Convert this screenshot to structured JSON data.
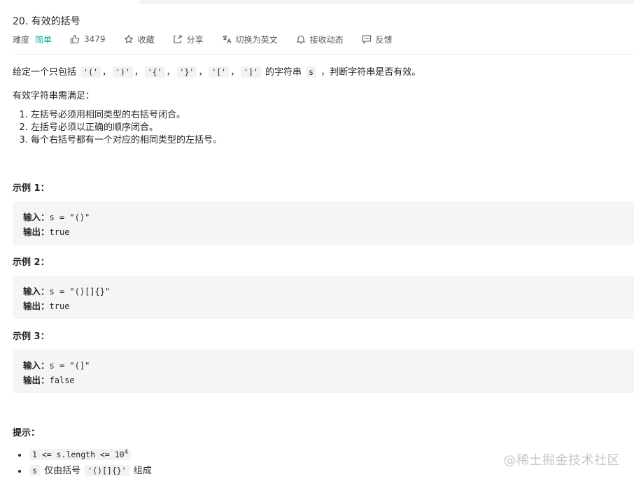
{
  "problem": {
    "title": "20. 有效的括号",
    "difficulty_label": "难度",
    "difficulty": "简单",
    "likes": "3479",
    "actions": [
      "收藏",
      "分享",
      "切换为英文",
      "接收动态",
      "反馈"
    ]
  },
  "description": {
    "intro_prefix": "给定一个只包括 ",
    "chars": [
      "'('",
      "')'",
      "'{'",
      "'}'",
      "'['",
      "']'"
    ],
    "intro_mid": " 的字符串 ",
    "var_s": "s",
    "intro_suffix": " ，判断字符串是否有效。",
    "requirement_heading": "有效字符串需满足：",
    "rules": [
      "左括号必须用相同类型的右括号闭合。",
      "左括号必须以正确的顺序闭合。",
      "每个右括号都有一个对应的相同类型的左括号。"
    ]
  },
  "examples": [
    {
      "title": "示例 1：",
      "input_label": "输入：",
      "input": "s = \"()\"",
      "output_label": "输出：",
      "output": "true"
    },
    {
      "title": "示例 2：",
      "input_label": "输入：",
      "input": "s = \"()[]{}\"",
      "output_label": "输出：",
      "output": "true"
    },
    {
      "title": "示例 3：",
      "input_label": "输入：",
      "input": "s = \"(]\"",
      "output_label": "输出：",
      "output": "false"
    }
  ],
  "hints": {
    "heading": "提示：",
    "constraint_prefix": "1 <= s.length <= 10",
    "constraint_exp": "4",
    "var_s": "s",
    "only_brackets_text": " 仅由括号 ",
    "brackets": "'()[]{}'",
    "composed_text": " 组成"
  },
  "watermark": "@稀土掘金技术社区",
  "colors": {
    "easy": "#00af9b",
    "code_bg": "#f5f5f5",
    "text": "#262626"
  },
  "icons": [
    "thumb-up-icon",
    "star-icon",
    "share-icon",
    "translate-icon",
    "bell-icon",
    "feedback-icon"
  ]
}
